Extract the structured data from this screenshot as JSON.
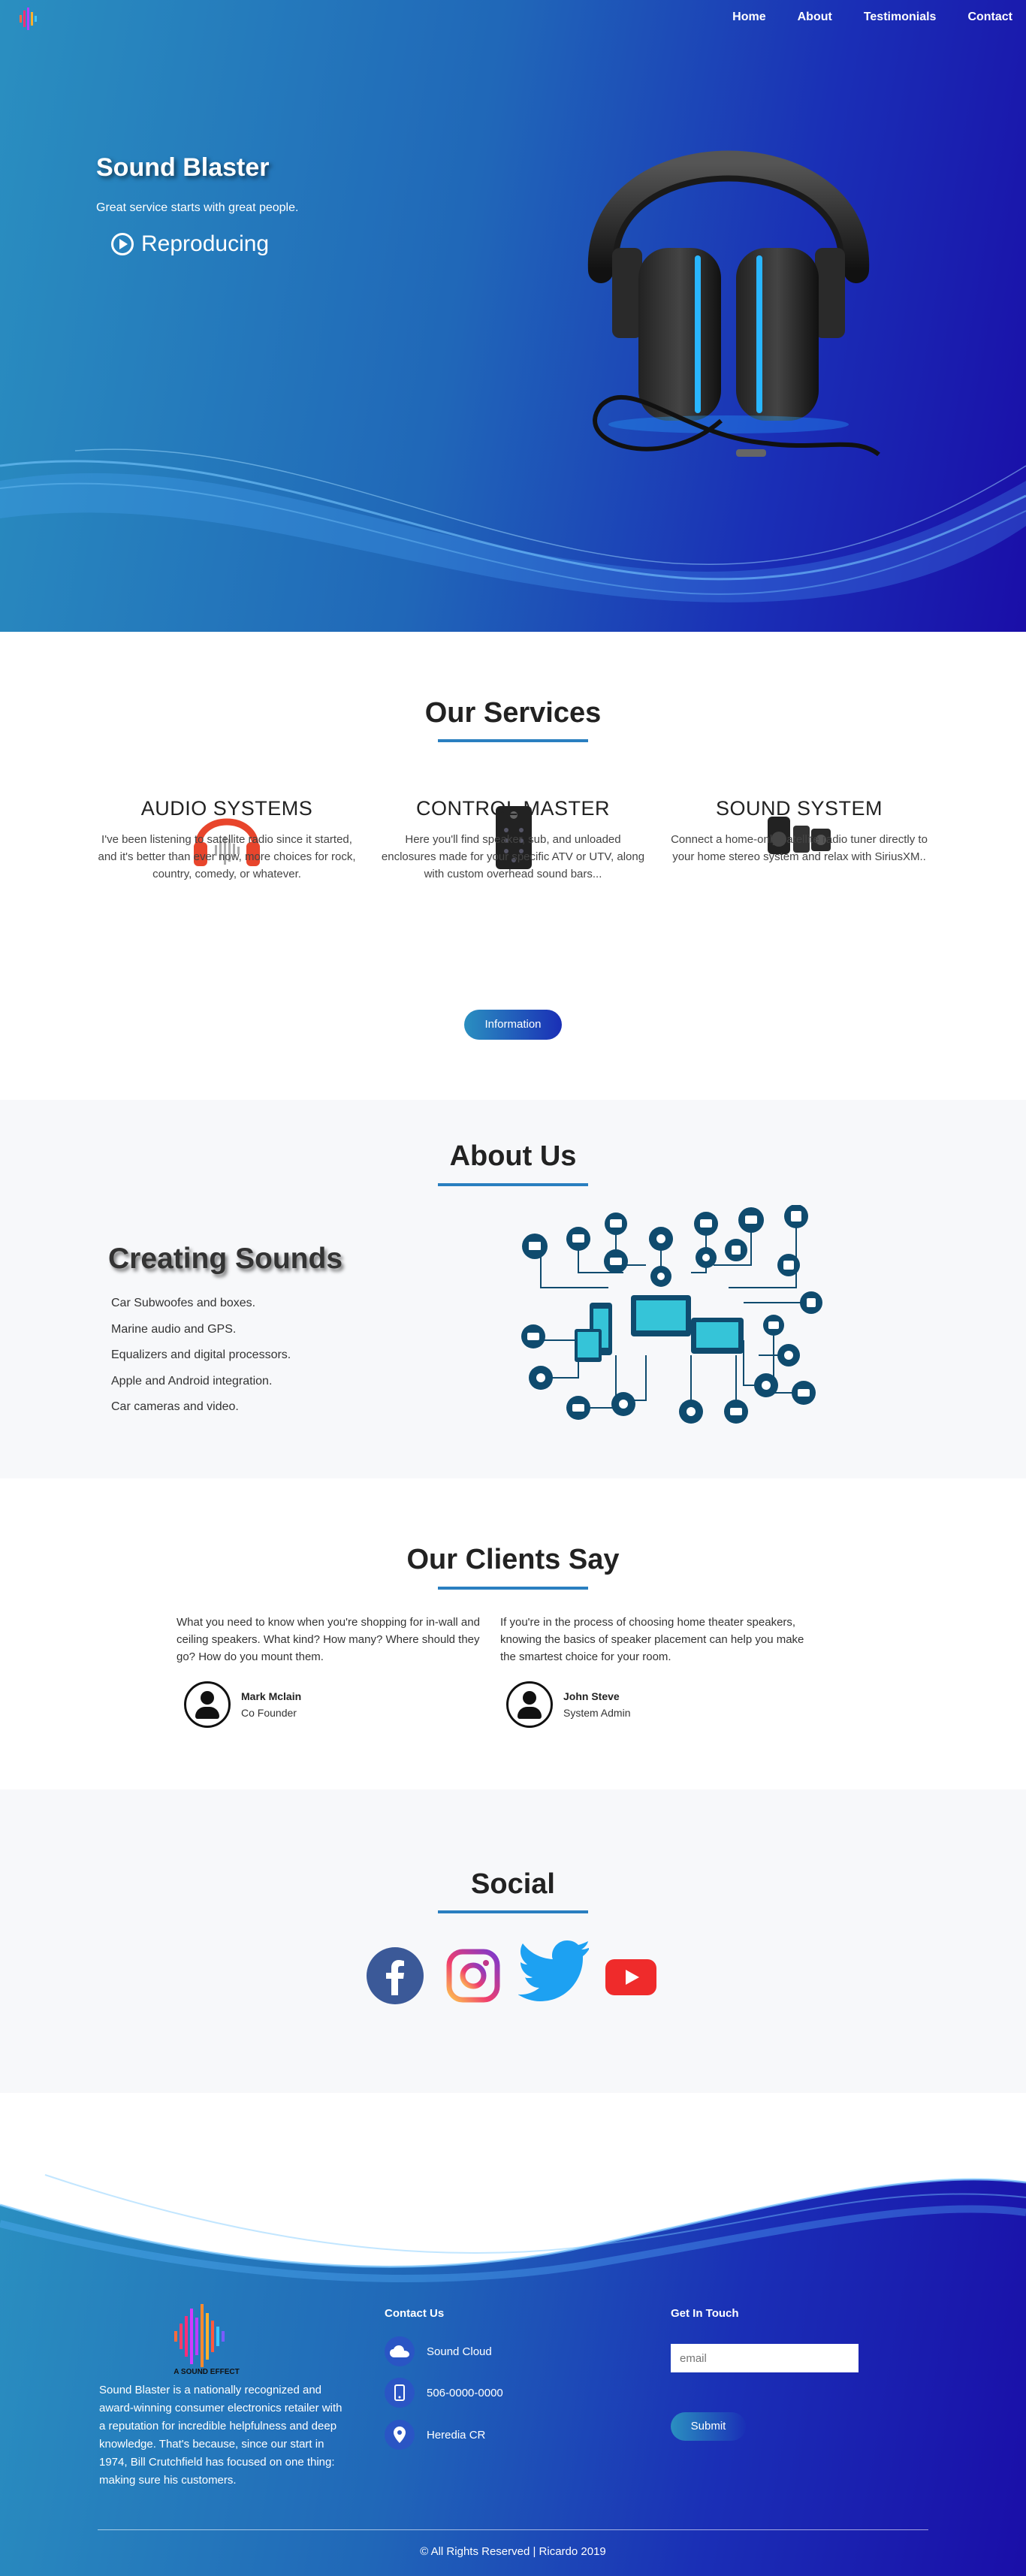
{
  "nav": {
    "items": [
      "Home",
      "About",
      "Testimonials",
      "Contact"
    ]
  },
  "hero": {
    "title": "Sound Blaster",
    "subtitle": "Great service starts with great people.",
    "play_label": "Reproducing"
  },
  "services": {
    "title": "Our Services",
    "items": [
      {
        "title": "AUDIO SYSTEMS",
        "text": "I've been listening to satellite radio since it started, and it's better than ever now, more choices for rock, country, comedy, or whatever.",
        "icon": "headphones-icon"
      },
      {
        "title": "CONTROL MASTER",
        "text": "Here you'll find speaker, sub, and unloaded enclosures made for your specific ATV or UTV, along with custom overhead sound bars...",
        "icon": "remote-icon"
      },
      {
        "title": "SOUND SYSTEM",
        "text": "Connect a home-only satellite radio tuner directly to your home stereo system and relax with SiriusXM..",
        "icon": "speakers-icon"
      }
    ],
    "button_label": "Information"
  },
  "about": {
    "title": "About Us",
    "heading": "Creating Sounds",
    "items": [
      "Car Subwoofes and boxes.",
      "Marine audio and GPS.",
      "Equalizers and digital processors.",
      "Apple and Android integration.",
      "Car cameras and video."
    ]
  },
  "clients": {
    "title": "Our Clients Say",
    "testimonials": [
      {
        "quote": "What you need to know when you're shopping for in-wall and ceiling speakers. What kind? How many? Where should they go? How do you mount them.",
        "name": "Mark Mclain",
        "role": "Co Founder"
      },
      {
        "quote": "If you're in the process of choosing home theater speakers, knowing the basics of speaker placement can help you make the smartest choice for your room.",
        "name": "John Steve",
        "role": "System Admin"
      }
    ]
  },
  "social": {
    "title": "Social",
    "icons": [
      "facebook-icon",
      "instagram-icon",
      "twitter-icon",
      "youtube-icon"
    ]
  },
  "footer": {
    "logo_text": "A SOUND EFFECT",
    "about": "Sound Blaster is a nationally recognized and award-winning consumer electronics retailer with a reputation for incredible helpfulness and deep knowledge. That's because, since our start in 1974, Bill Crutchfield has focused on one thing: making sure his customers.",
    "contact_title": "Contact Us",
    "contacts": [
      "Sound Cloud",
      "506-0000-0000",
      "Heredia CR"
    ],
    "touch_title": "Get In Touch",
    "email_placeholder": "email",
    "submit_label": "Submit",
    "copyright": "© All Rights Reserved | Ricardo 2019"
  },
  "colors": {
    "accent": "#2a7fc0",
    "gradient_start": "#2a8fc0",
    "gradient_end": "#1a0ea8"
  }
}
